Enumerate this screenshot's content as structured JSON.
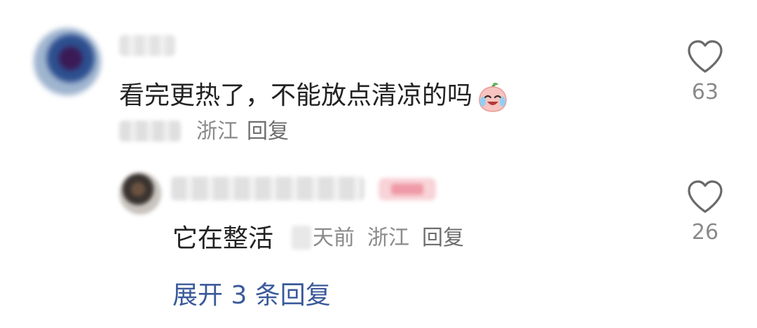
{
  "comment": {
    "text": "看完更热了，不能放点清凉的吗",
    "emoji": "crying-laughing-peach-emoji",
    "location": "浙江",
    "reply_label": "回复",
    "likes": "63"
  },
  "reply": {
    "text": "它在整活",
    "time_suffix": "天前",
    "location": "浙江",
    "reply_label": "回复",
    "likes": "26"
  },
  "expand_replies": "展开 3 条回复",
  "icons": {
    "like": "heart-outline-icon"
  },
  "colors": {
    "text_primary": "#222222",
    "text_secondary": "#8a8a8a",
    "link": "#3b5a9a"
  }
}
